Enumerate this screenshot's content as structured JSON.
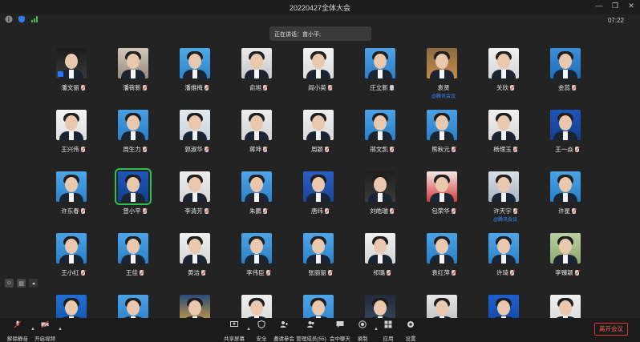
{
  "window": {
    "title": "20220427全体大会",
    "clock": "07:22"
  },
  "speaking": {
    "label": "正在讲话：曾小平;"
  },
  "participants": [
    {
      "name": "潘文丽",
      "mic": "muted",
      "colors": [
        "#1c1c1c",
        "#3a3a3a"
      ],
      "badge": true
    },
    {
      "name": "潘荷新",
      "mic": "muted",
      "colors": [
        "#d0c7bb",
        "#9a8b7a"
      ]
    },
    {
      "name": "潘维梅",
      "mic": "muted",
      "colors": [
        "#4ea9e8",
        "#2f85c9"
      ]
    },
    {
      "name": "俞旭",
      "mic": "muted",
      "colors": [
        "#e8e8e8",
        "#c9c9c9"
      ]
    },
    {
      "name": "阎小英",
      "mic": "muted",
      "colors": [
        "#f2f2f2",
        "#dcdcdc"
      ]
    },
    {
      "name": "庄立新",
      "mic": "on",
      "colors": [
        "#4fa3e6",
        "#2d7dc5"
      ]
    },
    {
      "name": "袁贤",
      "mic": "none",
      "sub": "@腾讯会议",
      "colors": [
        "#8c6a3f",
        "#c48b4a"
      ]
    },
    {
      "name": "关欣",
      "mic": "muted",
      "colors": [
        "#f0f0f0",
        "#d6d6d6"
      ]
    },
    {
      "name": "金蕊",
      "mic": "muted",
      "colors": [
        "#3b8fd9",
        "#1f6db8"
      ]
    },
    {
      "name": "王兴伟",
      "mic": "muted",
      "colors": [
        "#f5f5f5",
        "#dedede"
      ]
    },
    {
      "name": "周生力",
      "mic": "muted",
      "colors": [
        "#4aa0e3",
        "#2a7dc4"
      ]
    },
    {
      "name": "郭淑华",
      "mic": "muted",
      "colors": [
        "#e4e9ef",
        "#c8d2dc"
      ]
    },
    {
      "name": "蒋坤",
      "mic": "muted",
      "colors": [
        "#ececec",
        "#d4d4d4"
      ]
    },
    {
      "name": "周颖",
      "mic": "muted",
      "colors": [
        "#efefef",
        "#d9d9d9"
      ]
    },
    {
      "name": "邢文凯",
      "mic": "muted",
      "colors": [
        "#4da3e6",
        "#2b80c6"
      ]
    },
    {
      "name": "熊秋元",
      "mic": "muted",
      "colors": [
        "#4ba1e4",
        "#2c7ec5"
      ]
    },
    {
      "name": "杨理玉",
      "mic": "muted",
      "colors": [
        "#f1f1f1",
        "#d8d8d8"
      ]
    },
    {
      "name": "王一焱",
      "mic": "muted",
      "colors": [
        "#1f55b8",
        "#143f8f"
      ]
    },
    {
      "name": "许东春",
      "mic": "muted",
      "colors": [
        "#4ea6e9",
        "#2c83c9"
      ]
    },
    {
      "name": "曾小平",
      "mic": "muted",
      "active": true,
      "colors": [
        "#1e56b9",
        "#123f90"
      ]
    },
    {
      "name": "李清芳",
      "mic": "muted",
      "colors": [
        "#eeeeee",
        "#d5d5d5"
      ]
    },
    {
      "name": "朱鹏",
      "mic": "muted",
      "colors": [
        "#4fa5e8",
        "#2d82c7"
      ]
    },
    {
      "name": "唐纬",
      "mic": "muted",
      "colors": [
        "#2a5fc2",
        "#1a4596"
      ]
    },
    {
      "name": "刘皓瑞",
      "mic": "muted",
      "colors": [
        "#1e1e1e",
        "#3c3c3c"
      ]
    },
    {
      "name": "包荣华",
      "mic": "muted",
      "colors": [
        "#f4e9e6",
        "#cf3b3b"
      ]
    },
    {
      "name": "许天宇",
      "mic": "muted",
      "sub": "@腾讯会议",
      "colors": [
        "#d9dfe6",
        "#a8b4c2"
      ]
    },
    {
      "name": "许星",
      "mic": "muted",
      "colors": [
        "#4aa2e5",
        "#2a7fc5"
      ]
    },
    {
      "name": "王小红",
      "mic": "muted",
      "colors": [
        "#4aa3e6",
        "#2a80c6"
      ]
    },
    {
      "name": "王佳",
      "mic": "muted",
      "colors": [
        "#4da4e7",
        "#2b81c7"
      ]
    },
    {
      "name": "黄洁",
      "mic": "muted",
      "colors": [
        "#f0f0f0",
        "#d7d7d7"
      ]
    },
    {
      "name": "李伟臣",
      "mic": "muted",
      "colors": [
        "#4ca3e6",
        "#2b80c6"
      ]
    },
    {
      "name": "张丽丽",
      "mic": "muted",
      "colors": [
        "#4fa6e8",
        "#2d83c8"
      ]
    },
    {
      "name": "祁璐",
      "mic": "muted",
      "colors": [
        "#efefef",
        "#d6d6d6"
      ]
    },
    {
      "name": "袁红萍",
      "mic": "muted",
      "colors": [
        "#4ba2e5",
        "#2b7fc5"
      ]
    },
    {
      "name": "许琦",
      "mic": "muted",
      "colors": [
        "#4ea5e8",
        "#2c82c8"
      ]
    },
    {
      "name": "李臻颖",
      "mic": "muted",
      "colors": [
        "#b9cfa0",
        "#8fa96c"
      ]
    },
    {
      "name": "",
      "mic": "none",
      "colors": [
        "#1f6fd6",
        "#1554a8"
      ]
    },
    {
      "name": "",
      "mic": "none",
      "colors": [
        "#4aa2e5",
        "#2a7fc5"
      ]
    },
    {
      "name": "",
      "mic": "none",
      "colors": [
        "#2b4a7a",
        "#d9a441"
      ]
    },
    {
      "name": "",
      "mic": "none",
      "colors": [
        "#f0f0f0",
        "#d8d8d8"
      ]
    },
    {
      "name": "",
      "mic": "none",
      "colors": [
        "#4ea6e9",
        "#2c83c9"
      ]
    },
    {
      "name": "",
      "mic": "none",
      "colors": [
        "#1f2a3a",
        "#3a4a60"
      ]
    },
    {
      "name": "",
      "mic": "none",
      "colors": [
        "#e6e6e6",
        "#bdbdbd"
      ]
    },
    {
      "name": "",
      "mic": "none",
      "colors": [
        "#1d5fd0",
        "#1447a0"
      ]
    },
    {
      "name": "",
      "mic": "none",
      "colors": [
        "#f0f0f0",
        "#d8d8d8"
      ]
    }
  ],
  "toolbar": {
    "unmute": "解除静音",
    "start_video": "开启视频",
    "share_screen": "共享屏幕",
    "security": "安全",
    "invite": "邀请参会",
    "manage_members": "管理成员(55)",
    "chat": "会中聊天",
    "record": "录制",
    "apps": "应用",
    "settings": "设置",
    "leave": "离开会议"
  },
  "colors": {
    "accent_blue": "#3a8dff",
    "active_green": "#2fbf4f",
    "leave_red": "#ff5a5a"
  }
}
